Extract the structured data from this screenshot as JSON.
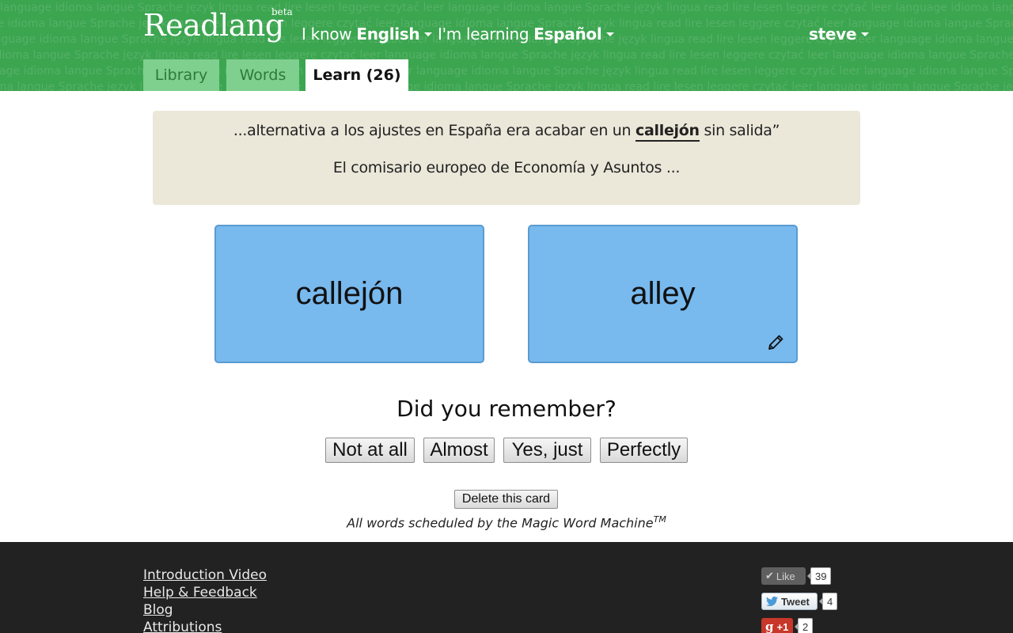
{
  "header": {
    "logo": "Readlang",
    "beta": "beta",
    "know_prefix": "I know",
    "know_lang": "English",
    "learning_prefix": "I'm learning",
    "learning_lang": "Español",
    "user": "steve",
    "background_words": "language idioma langue Sprache język lingua read lire lesen leggere czytać leer language idioma langue Sprache język lingua read lire lesen leggere czytać leer language idioma langue Sprache język lingua read lire lesen leggere czytać leer"
  },
  "tabs": {
    "library": "Library",
    "words": "Words",
    "learn": "Learn (26)"
  },
  "context": {
    "line1_before": "...alternativa a los ajustes en España era acabar en un",
    "line1_word": "callejón",
    "line1_after": "sin salida”",
    "line2": "El comisario europeo de Economía y Asuntos ..."
  },
  "cards": {
    "front": "callejón",
    "back": "alley",
    "edit_icon": "pencil-icon"
  },
  "question": "Did you remember?",
  "answers": {
    "not_at_all": "Not at all",
    "almost": "Almost",
    "yes_just": "Yes, just",
    "perfectly": "Perfectly"
  },
  "delete_button": "Delete this card",
  "scheduled_text": "All words scheduled by the Magic Word Machine",
  "scheduled_tm": "TM",
  "footer": {
    "links": [
      "Introduction Video",
      "Help & Feedback",
      "Blog",
      "Attributions"
    ],
    "social": {
      "like_label": "Like",
      "like_count": "39",
      "tweet_label": "Tweet",
      "tweet_count": "4",
      "gplus_label": "+1",
      "gplus_count": "2"
    }
  },
  "colors": {
    "header_green": "#3ca550",
    "tab_inactive": "#7fcf8f",
    "card_blue": "#78b9ee",
    "context_bg": "#ebe7d9",
    "footer_bg": "#222222"
  }
}
